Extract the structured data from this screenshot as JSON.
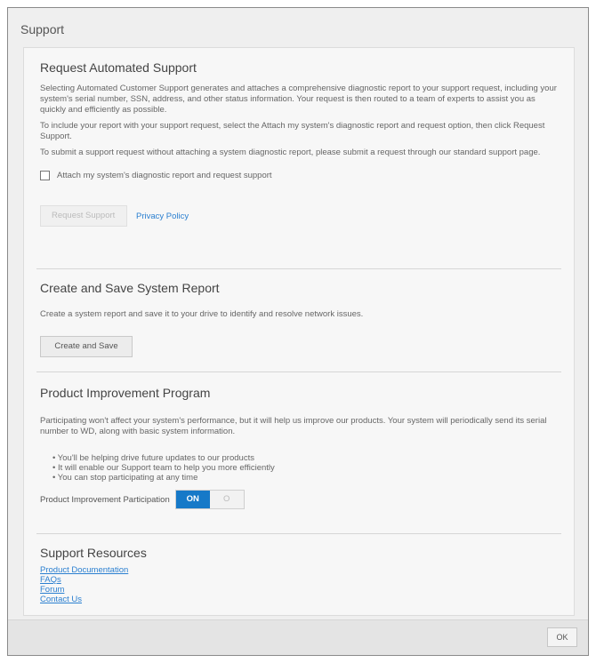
{
  "dialog": {
    "title": "Support"
  },
  "automated": {
    "title": "Request Automated Support",
    "para1": "Selecting Automated Customer Support generates and attaches a comprehensive diagnostic report to your support request, including your system's serial number, SSN, address, and other status information. Your request is then routed to a team of experts to assist you as quickly and efficiently as possible.",
    "para2": "To include your report with your support request, select the Attach my system's diagnostic report and request option, then click Request Support.",
    "para3": "To submit a support request without attaching a system diagnostic report, please submit a request through our standard support page.",
    "checkbox_label": "Attach my system's diagnostic report and request support",
    "request_button": "Request Support",
    "privacy_link": "Privacy Policy"
  },
  "report": {
    "title": "Create and Save System Report",
    "para": "Create a system report and save it to your drive to identify and resolve network issues.",
    "button": "Create and Save"
  },
  "improvement": {
    "title": "Product Improvement Program",
    "para": "Participating won't affect your system's performance, but it will help us improve our products. Your system will periodically send its serial number to WD, along with basic system information.",
    "bullets": [
      "You'll be helping drive future updates to our products",
      "It will enable our Support team to help you more efficiently",
      "You can stop participating at any time"
    ],
    "toggle_label": "Product Improvement Participation",
    "toggle_on": "ON",
    "toggle_off": "O"
  },
  "resources": {
    "title": "Support Resources",
    "links": [
      "Product Documentation",
      "FAQs",
      "Forum",
      "Contact Us"
    ]
  },
  "footer": {
    "ok_button": "OK"
  }
}
